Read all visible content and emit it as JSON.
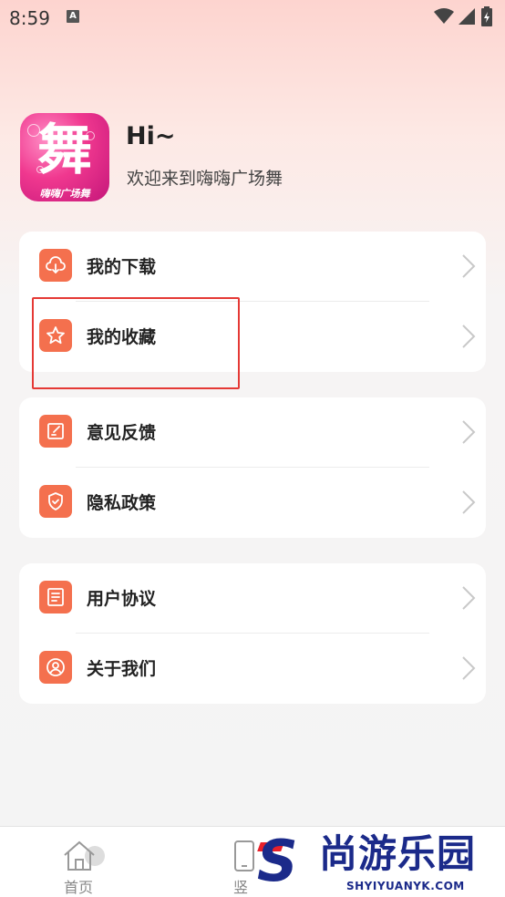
{
  "status_bar": {
    "time": "8:59",
    "notification_badge": "A"
  },
  "profile": {
    "greeting": "Hi~",
    "subtitle": "欢迎来到嗨嗨广场舞",
    "logo_glyph": "舞",
    "logo_caption": "嗨嗨广场舞"
  },
  "menu_groups": [
    {
      "items": [
        {
          "label": "我的下载",
          "icon": "cloud-download-icon"
        },
        {
          "label": "我的收藏",
          "icon": "star-icon"
        }
      ]
    },
    {
      "items": [
        {
          "label": "意见反馈",
          "icon": "edit-icon"
        },
        {
          "label": "隐私政策",
          "icon": "shield-check-icon"
        }
      ]
    },
    {
      "items": [
        {
          "label": "用户协议",
          "icon": "document-icon"
        },
        {
          "label": "关于我们",
          "icon": "user-icon"
        }
      ]
    }
  ],
  "bottom_nav": [
    {
      "label": "首页",
      "icon": "home-icon"
    },
    {
      "label": "竖",
      "icon": "phone-icon"
    }
  ],
  "watermark": {
    "brand": "尚游乐园",
    "url": "SHYIYUANYK.COM"
  },
  "colors": {
    "accent": "#f4704e",
    "highlight": "#e53935",
    "watermark": "#1b2a8a"
  }
}
